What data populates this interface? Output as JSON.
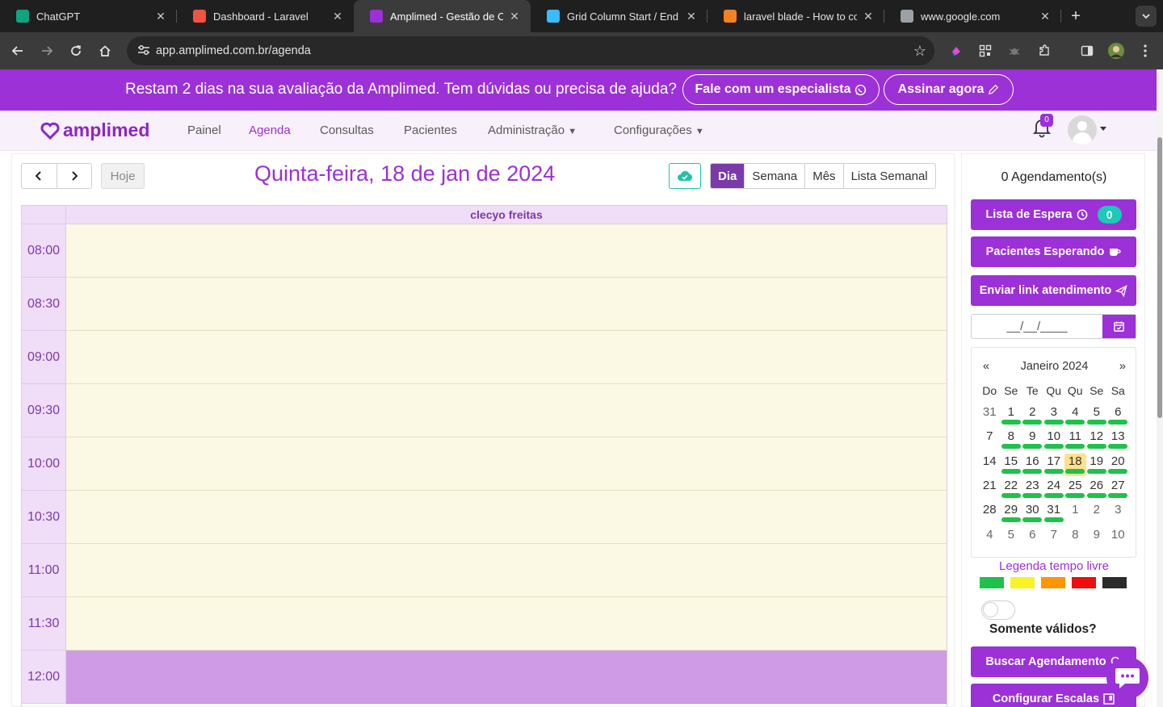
{
  "browser": {
    "tabs": [
      {
        "title": "ChatGPT",
        "active": false,
        "favicon_color": "#10a37f"
      },
      {
        "title": "Dashboard - Laravel",
        "active": false,
        "favicon_color": "#f05340"
      },
      {
        "title": "Amplimed - Gestão de Clíni",
        "active": true,
        "favicon_color": "#9b31d6"
      },
      {
        "title": "Grid Column Start / End -",
        "active": false,
        "favicon_color": "#38bdf8"
      },
      {
        "title": "laravel blade - How to con",
        "active": false,
        "favicon_color": "#f48024"
      },
      {
        "title": "www.google.com",
        "active": false,
        "favicon_color": "#9aa0a6"
      }
    ],
    "url": "app.amplimed.com.br/agenda"
  },
  "banner": {
    "message": "Restam 2 dias na sua avaliação da Amplimed. Tem dúvidas ou precisa de ajuda?",
    "specialist_label": "Fale com um especialista",
    "subscribe_label": "Assinar agora"
  },
  "nav": {
    "logo_text": "amplimed",
    "items": [
      "Painel",
      "Agenda",
      "Consultas",
      "Pacientes",
      "Administração",
      "Configurações"
    ],
    "active_item": "Agenda",
    "notification_count": "0"
  },
  "calendar": {
    "today_label": "Hoje",
    "title": "Quinta-feira, 18 de jan de 2024",
    "views": [
      "Dia",
      "Semana",
      "Mês",
      "Lista Semanal"
    ],
    "active_view": "Dia",
    "professional": "clecyo freitas",
    "time_slots": [
      {
        "time": "08:00",
        "blocked": false
      },
      {
        "time": "08:30",
        "blocked": false
      },
      {
        "time": "09:00",
        "blocked": false
      },
      {
        "time": "09:30",
        "blocked": false
      },
      {
        "time": "10:00",
        "blocked": false
      },
      {
        "time": "10:30",
        "blocked": false
      },
      {
        "time": "11:00",
        "blocked": false
      },
      {
        "time": "11:30",
        "blocked": false
      },
      {
        "time": "12:00",
        "blocked": true
      }
    ]
  },
  "sidebar": {
    "count_label": "0 Agendamento(s)",
    "waiting_list_label": "Lista de Espera",
    "waiting_list_count": "0",
    "patients_waiting_label": "Pacientes Esperando",
    "send_link_label": "Enviar link atendimento",
    "date_input_placeholder": "__/__/____",
    "mini_calendar": {
      "prev": "«",
      "month": "Janeiro 2024",
      "next": "»",
      "weekdays": [
        "Do",
        "Se",
        "Te",
        "Qu",
        "Qu",
        "Se",
        "Sa"
      ],
      "weeks": [
        [
          {
            "d": "31",
            "o": true,
            "a": false
          },
          {
            "d": "1",
            "o": false,
            "a": true
          },
          {
            "d": "2",
            "o": false,
            "a": true
          },
          {
            "d": "3",
            "o": false,
            "a": true
          },
          {
            "d": "4",
            "o": false,
            "a": true
          },
          {
            "d": "5",
            "o": false,
            "a": true
          },
          {
            "d": "6",
            "o": false,
            "a": true
          }
        ],
        [
          {
            "d": "7",
            "o": false,
            "a": false
          },
          {
            "d": "8",
            "o": false,
            "a": true
          },
          {
            "d": "9",
            "o": false,
            "a": true
          },
          {
            "d": "10",
            "o": false,
            "a": true
          },
          {
            "d": "11",
            "o": false,
            "a": true
          },
          {
            "d": "12",
            "o": false,
            "a": true
          },
          {
            "d": "13",
            "o": false,
            "a": true
          }
        ],
        [
          {
            "d": "14",
            "o": false,
            "a": false
          },
          {
            "d": "15",
            "o": false,
            "a": true
          },
          {
            "d": "16",
            "o": false,
            "a": true
          },
          {
            "d": "17",
            "o": false,
            "a": true
          },
          {
            "d": "18",
            "o": false,
            "a": true,
            "t": true
          },
          {
            "d": "19",
            "o": false,
            "a": true
          },
          {
            "d": "20",
            "o": false,
            "a": true
          }
        ],
        [
          {
            "d": "21",
            "o": false,
            "a": false
          },
          {
            "d": "22",
            "o": false,
            "a": true
          },
          {
            "d": "23",
            "o": false,
            "a": true
          },
          {
            "d": "24",
            "o": false,
            "a": true
          },
          {
            "d": "25",
            "o": false,
            "a": true
          },
          {
            "d": "26",
            "o": false,
            "a": true
          },
          {
            "d": "27",
            "o": false,
            "a": true
          }
        ],
        [
          {
            "d": "28",
            "o": false,
            "a": false
          },
          {
            "d": "29",
            "o": false,
            "a": true
          },
          {
            "d": "30",
            "o": false,
            "a": true
          },
          {
            "d": "31",
            "o": false,
            "a": true
          },
          {
            "d": "1",
            "o": true,
            "a": false
          },
          {
            "d": "2",
            "o": true,
            "a": false
          },
          {
            "d": "3",
            "o": true,
            "a": false
          }
        ],
        [
          {
            "d": "4",
            "o": true,
            "a": false
          },
          {
            "d": "5",
            "o": true,
            "a": false
          },
          {
            "d": "6",
            "o": true,
            "a": false
          },
          {
            "d": "7",
            "o": true,
            "a": false
          },
          {
            "d": "8",
            "o": true,
            "a": false
          },
          {
            "d": "9",
            "o": true,
            "a": false
          },
          {
            "d": "10",
            "o": true,
            "a": false
          }
        ]
      ]
    },
    "legend_title": "Legenda tempo livre",
    "legend_colors": [
      "#1ec24a",
      "#f7f325",
      "#ff9500",
      "#f00d0d",
      "#2b2b2b"
    ],
    "only_valid_label": "Somente válidos?",
    "search_label": "Buscar Agendamento",
    "schedules_label": "Configurar Escalas"
  },
  "colors": {
    "brand": "#9b31d6",
    "slot_free": "#fbf9e3",
    "slot_blocked": "#cf9be6"
  }
}
